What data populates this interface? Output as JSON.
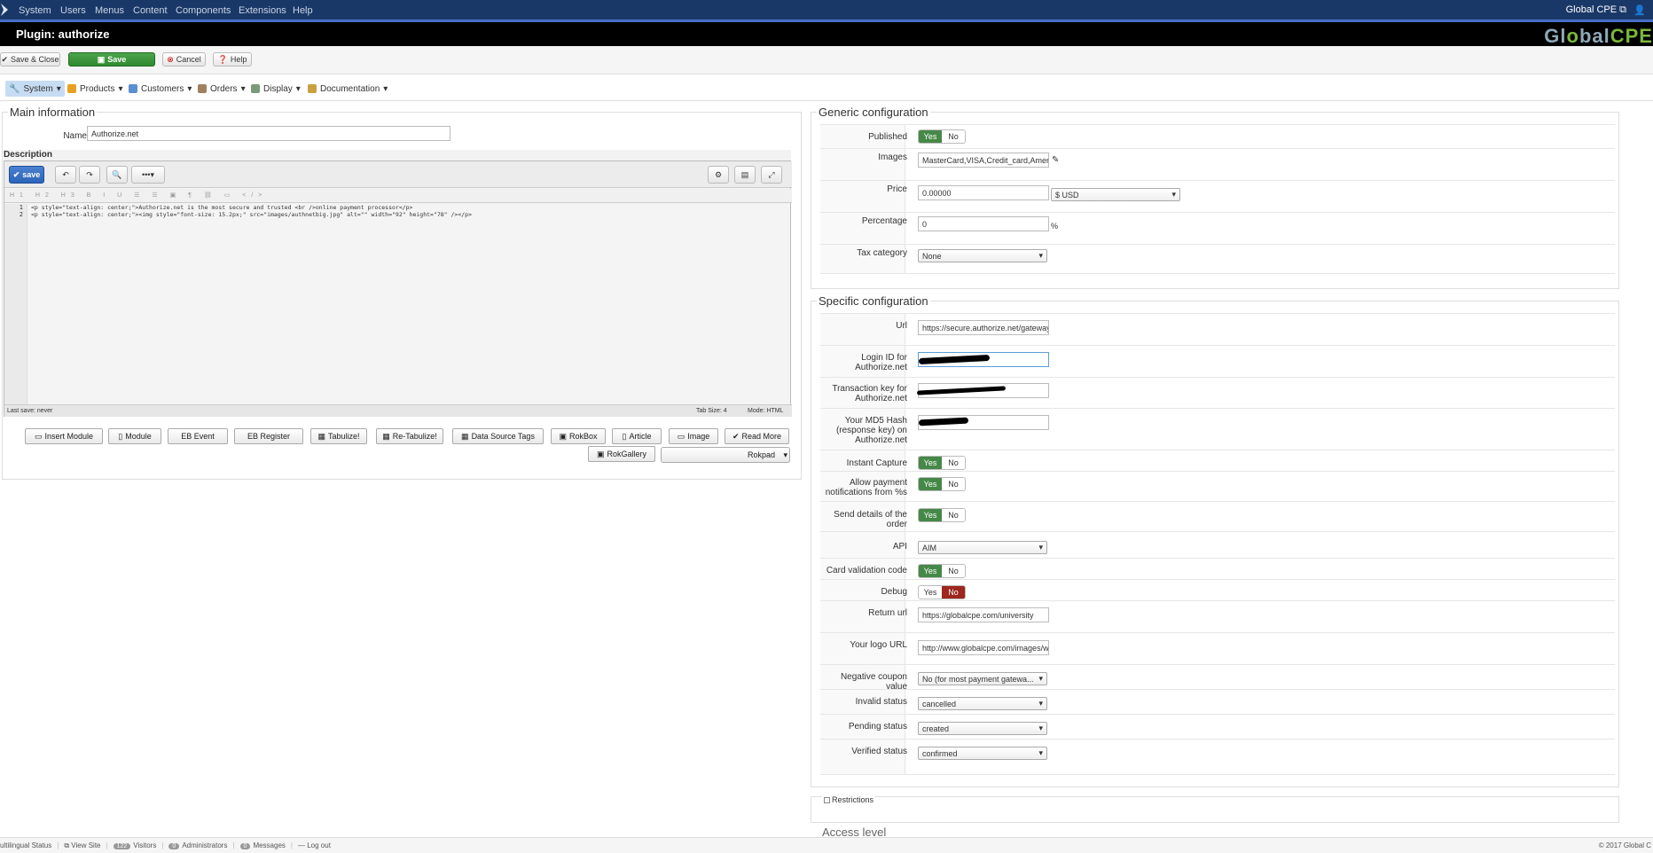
{
  "nav": {
    "items": [
      "System",
      "Users",
      "Menus",
      "Content",
      "Components",
      "Extensions",
      "Help"
    ],
    "user": "Global CPE"
  },
  "title": "Plugin: authorize",
  "brand": {
    "g": "Gl",
    "o": "o",
    "bal": "bal",
    "cpe": "CPE"
  },
  "toolbar": {
    "save_close": "Save & Close",
    "save": "Save",
    "cancel": "Cancel",
    "help": "Help"
  },
  "submenu": [
    "System",
    "Products",
    "Customers",
    "Orders",
    "Display",
    "Documentation"
  ],
  "main": {
    "legend": "Main information",
    "name_label": "Name",
    "name_value": "Authorize.net",
    "description_label": "Description",
    "editor": {
      "save": "save",
      "lines": [
        "1",
        "2"
      ],
      "code1": "<p style=\"text-align: center;\">Authorize.net is the most secure and trusted <br />online payment processor</p>",
      "code2": "<p style=\"text-align: center;\"><img style=\"font-size: 15.2px;\" src=\"images/authnetbig.jpg\" alt=\"\" width=\"92\" height=\"78\" /></p>",
      "last_save": "Last save: never",
      "tab_size": "Tab Size: 4",
      "mode": "Mode: HTML"
    },
    "buttons": [
      "Insert Module",
      "Module",
      "EB Event",
      "EB Register",
      "Tabulize!",
      "Re-Tabulize!",
      "Data Source Tags",
      "RokBox",
      "Article",
      "Image",
      "Read More",
      "RokGallery"
    ],
    "rokpad": "Rokpad"
  },
  "generic": {
    "legend": "Generic configuration",
    "published": "Published",
    "images": "Images",
    "images_value": "MasterCard,VISA,Credit_card,Amer",
    "price": "Price",
    "price_value": "0.00000",
    "currency": "$ USD",
    "percentage": "Percentage",
    "percentage_value": "0",
    "percent_sign": "%",
    "tax_category": "Tax category",
    "tax_value": "None"
  },
  "specific": {
    "legend": "Specific configuration",
    "url": "Url",
    "url_value": "https://secure.authorize.net/gateway",
    "login": "Login ID for Authorize.net",
    "txkey": "Transaction key for Authorize.net",
    "md5": "Your MD5 Hash (response key) on Authorize.net",
    "instant": "Instant Capture",
    "allow": "Allow payment notifications from %s",
    "send": "Send details of the order",
    "api": "API",
    "api_value": "AIM",
    "cvc": "Card validation code",
    "debug": "Debug",
    "return_url": "Return url",
    "return_value": "https://globalcpe.com/university",
    "logo_url": "Your logo URL",
    "logo_value": "http://www.globalcpe.com/images/we",
    "neg_coupon": "Negative coupon value",
    "neg_value": "No (for most payment gatewa...",
    "invalid": "Invalid status",
    "invalid_value": "cancelled",
    "pending": "Pending status",
    "pending_value": "created",
    "verified": "Verified status",
    "verified_value": "confirmed"
  },
  "yes": "Yes",
  "no": "No",
  "restrictions": "Restrictions",
  "access": "Access level",
  "footer": {
    "multilingual": "ultilingual Status",
    "view_site": "View Site",
    "visitors_count": "122",
    "visitors": "Visitors",
    "admins_count": "0",
    "admins": "Administrators",
    "messages_count": "0",
    "messages": "Messages",
    "logout": "Log out",
    "copyright": "© 2017 Global C"
  },
  "colors": {
    "nav": "#1a3867",
    "green": "#468847",
    "red": "#9d261d",
    "accent": "#7ab83a"
  }
}
